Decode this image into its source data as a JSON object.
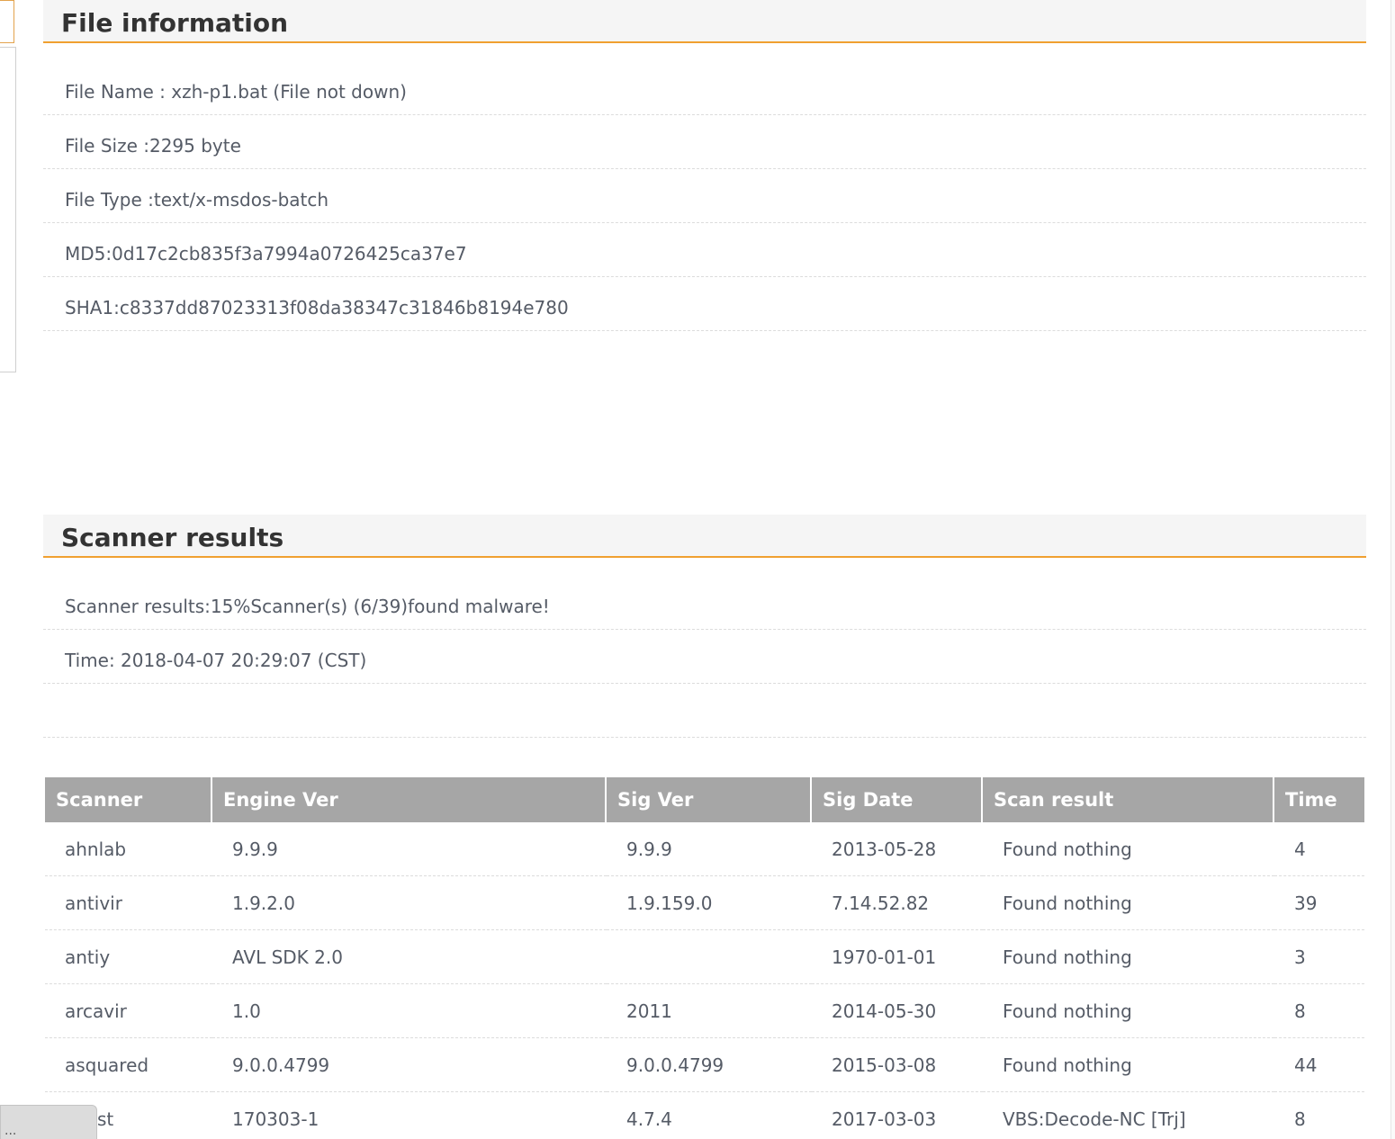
{
  "file_info": {
    "title": "File information",
    "rows": [
      "File Name : xzh-p1.bat (File not down)",
      "File Size :2295 byte",
      "File Type :text/x-msdos-batch",
      "MD5:0d17c2cb835f3a7994a0726425ca37e7",
      "SHA1:c8337dd87023313f08da38347c31846b8194e780"
    ]
  },
  "scanner": {
    "title": "Scanner results",
    "summary": "Scanner results:15%Scanner(s) (6/39)found malware!",
    "time": "Time: 2018-04-07 20:29:07 (CST)",
    "headers": [
      "Scanner",
      "Engine Ver",
      "Sig Ver",
      "Sig Date",
      "Scan result",
      "Time"
    ],
    "rows": [
      {
        "scanner": "ahnlab",
        "engine": "9.9.9",
        "sig": "9.9.9",
        "date": "2013-05-28",
        "result": "Found nothing",
        "time": "4"
      },
      {
        "scanner": "antivir",
        "engine": "1.9.2.0",
        "sig": "1.9.159.0",
        "date": "7.14.52.82",
        "result": "Found nothing",
        "time": "39"
      },
      {
        "scanner": "antiy",
        "engine": "AVL SDK 2.0",
        "sig": "",
        "date": "1970-01-01",
        "result": "Found nothing",
        "time": "3"
      },
      {
        "scanner": "arcavir",
        "engine": "1.0",
        "sig": "2011",
        "date": "2014-05-30",
        "result": "Found nothing",
        "time": "8"
      },
      {
        "scanner": "asquared",
        "engine": "9.0.0.4799",
        "sig": "9.0.0.4799",
        "date": "2015-03-08",
        "result": "Found nothing",
        "time": "44"
      },
      {
        "scanner": "st",
        "engine": "170303-1",
        "sig": "4.7.4",
        "date": "2017-03-03",
        "result": "VBS:Decode-NC [Trj]",
        "time": "8"
      }
    ]
  },
  "status_bar": {
    "text": "..."
  }
}
